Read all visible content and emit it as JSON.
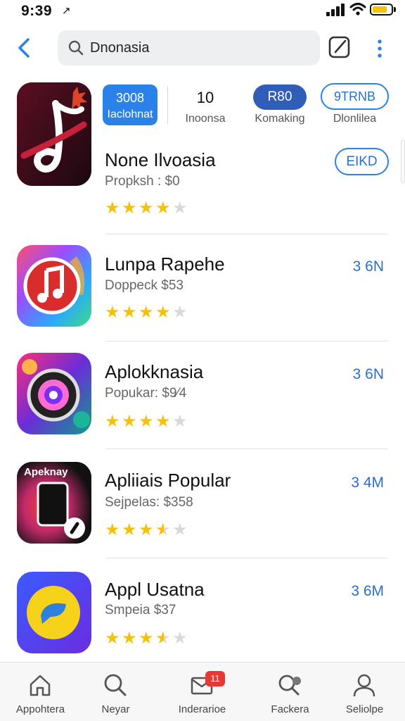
{
  "status_bar": {
    "time": "9:39",
    "arrow": "↗"
  },
  "search": {
    "query": "Dnonasia"
  },
  "featured": {
    "metric_pill_line1": "3008",
    "metric_pill_line2": "Iaclohnat",
    "metric_count": "10",
    "metric_count_label": "Inoonsa",
    "metric_rank": "R80",
    "metric_rank_label": "Komaking",
    "metric_age": "9TRNB",
    "metric_age_label": "Dlonlilea",
    "name": "None Ilvoasia",
    "subtitle": "Propksh : $0",
    "rating": 4,
    "action_label": "EIKD"
  },
  "apps": [
    {
      "name": "Lunpa Rapehe",
      "subtitle": "Doppeck $53",
      "rating": 4,
      "size": "3 6N"
    },
    {
      "name": "Aplokknasia",
      "subtitle": "Popukar: $9⁄4",
      "rating": 4,
      "size": "3 6N"
    },
    {
      "name": "Apliiais Popular",
      "subtitle": "Sejpelas: $358",
      "rating": 3.5,
      "size": "3 4M"
    },
    {
      "name": "Appl Usatna",
      "subtitle": "Smpeia $37",
      "rating": 3.5,
      "size": "3 6M"
    }
  ],
  "icon_text": {
    "app3": "Apeknay"
  },
  "tabs": [
    {
      "label": "Appohtera",
      "icon": "home-icon"
    },
    {
      "label": "Neyar",
      "icon": "search-icon"
    },
    {
      "label": "Inderarioe",
      "icon": "inbox-icon",
      "badge": "11"
    },
    {
      "label": "Fackera",
      "icon": "discover-icon"
    },
    {
      "label": "Seliolpe",
      "icon": "profile-icon"
    }
  ],
  "colors": {
    "accent": "#2a82e8",
    "star": "#f4c20d",
    "badge": "#e53935"
  }
}
